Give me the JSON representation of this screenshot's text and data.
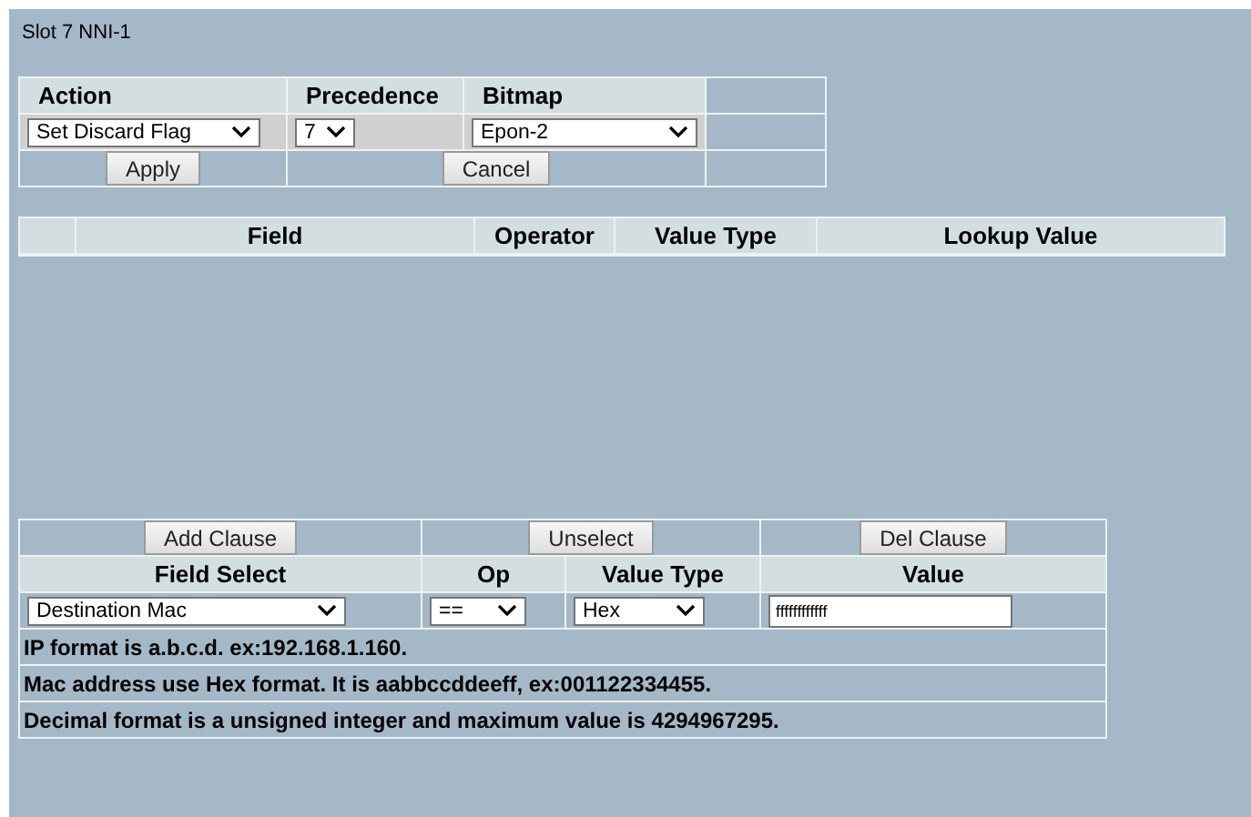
{
  "title": "Slot 7 NNI-1",
  "action_table": {
    "headers": [
      "Action",
      "Precedence",
      "Bitmap"
    ],
    "action": {
      "value": "Set Discard Flag"
    },
    "precedence": {
      "value": "7"
    },
    "bitmap": {
      "value": "Epon-2"
    },
    "buttons": [
      "Apply",
      "Cancel"
    ]
  },
  "clause_table": {
    "columns": [
      "Field",
      "Operator",
      "Value Type",
      "Lookup Value"
    ]
  },
  "editor": {
    "buttons": [
      "Add Clause",
      "Unselect",
      "Del Clause"
    ],
    "headers": [
      "Field Select",
      "Op",
      "Value Type",
      "Value"
    ],
    "field_select": {
      "value": "Destination Mac"
    },
    "op": {
      "value": "=="
    },
    "value_type": {
      "value": "Hex"
    },
    "value": {
      "value": "ffffffffffff"
    },
    "notes": [
      "IP format is a.b.c.d. ex:192.168.1.160.",
      "Mac address use Hex format. It is aabbccddeeff, ex:001122334455.",
      "Decimal format is a unsigned integer and maximum value is 4294967295."
    ]
  }
}
